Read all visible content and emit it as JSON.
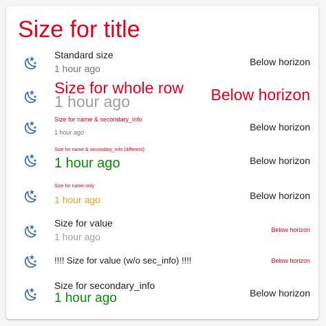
{
  "card": {
    "title": "Size for title",
    "entities": [
      {
        "name": "Standard size",
        "secondary": "1 hour ago",
        "value": "Below horizon",
        "icon": "weather-night-icon"
      },
      {
        "name": "Size for whole row",
        "secondary": "1 hour ago",
        "value": "Below horizon",
        "icon": "weather-night-icon"
      },
      {
        "name": "Size for name & secondary_info",
        "secondary": "1 hour ago",
        "value": "Below horizon",
        "icon": "weather-night-icon"
      },
      {
        "name": "Size for name & secondary_info (different)",
        "secondary": "1 hour ago",
        "value": "Below horizon",
        "icon": "weather-night-icon"
      },
      {
        "name": "Size for name only",
        "secondary": "1 hour ago",
        "value": "Below horizon",
        "icon": "weather-night-icon"
      },
      {
        "name": "Size for value",
        "secondary": "1 hour ago",
        "value": "Below horizon",
        "icon": "weather-night-icon"
      },
      {
        "name": "!!!! Size for value (w/o sec_info) !!!!",
        "value": "Below horizon",
        "icon": "weather-night-icon"
      },
      {
        "name": "Size for secondary_info",
        "secondary": "1 hour ago",
        "value": "Below horizon",
        "icon": "weather-night-icon"
      }
    ]
  },
  "colors": {
    "title": "#e3001b",
    "icon": "#44739e",
    "text_primary": "#212121",
    "text_secondary": "#727272",
    "red": "#e3001b",
    "green": "#0a8a0a",
    "orange": "#e8a11c",
    "gray": "#9e9e9e"
  }
}
